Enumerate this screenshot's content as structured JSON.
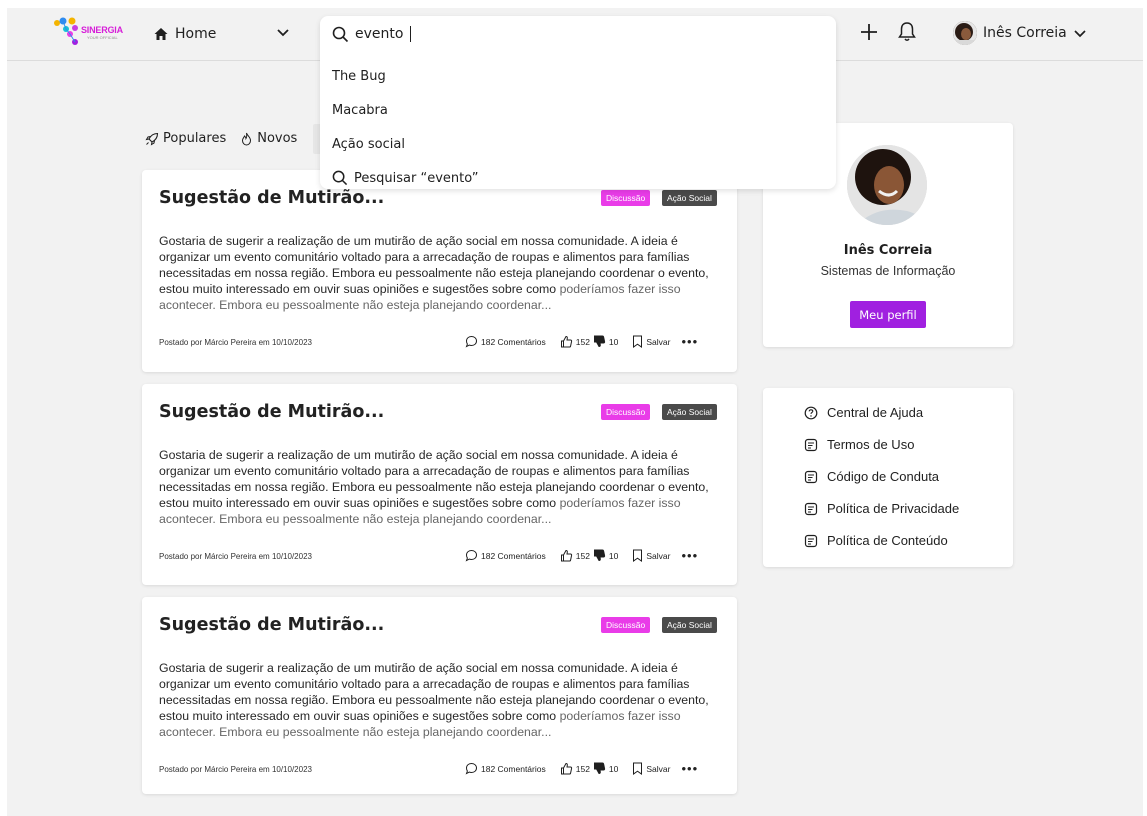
{
  "brand": {
    "name": "SINERGIA",
    "tagline": "YOUR OFFICIAL",
    "accent": "#a020e0",
    "tag_pink": "#e93ce8",
    "tag_dark": "#4a4a4a"
  },
  "nav": {
    "home_label": "Home"
  },
  "search": {
    "value": "evento",
    "suggestions": [
      "The Bug",
      "Macabra",
      "Ação social"
    ],
    "search_action": "Pesquisar “evento”"
  },
  "user": {
    "name": "Inês Correia"
  },
  "filters": [
    {
      "label": "Populares",
      "icon": "rocket-icon"
    },
    {
      "label": "Novos",
      "icon": "flame-icon"
    }
  ],
  "posts": [
    {
      "title": "Sugestão de Mutirão...",
      "tags": [
        "Discussão",
        "Ação Social"
      ],
      "body": "Gostaria de sugerir a realização de um mutirão de ação social em nossa comunidade. A ideia é organizar um evento comunitário voltado para a arrecadação de roupas e alimentos para famílias necessitadas em nossa região. Embora eu pessoalmente não esteja planejando coordenar o evento, estou muito interessado em ouvir suas opiniões e sugestões sobre como",
      "body_fade": "poderíamos fazer isso acontecer. Embora eu pessoalmente não esteja planejando coordenar...",
      "meta": "Postado por Márcio Pereira em 10/10/2023",
      "comments": "182 Comentários",
      "likes": "152",
      "dislikes": "10",
      "save": "Salvar"
    },
    {
      "title": "Sugestão de Mutirão...",
      "tags": [
        "Discussão",
        "Ação Social"
      ],
      "body": "Gostaria de sugerir a realização de um mutirão de ação social em nossa comunidade. A ideia é organizar um evento comunitário voltado para a arrecadação de roupas e alimentos para famílias necessitadas em nossa região. Embora eu pessoalmente não esteja planejando coordenar o evento, estou muito interessado em ouvir suas opiniões e sugestões sobre como",
      "body_fade": "poderíamos fazer isso acontecer. Embora eu pessoalmente não esteja planejando coordenar...",
      "meta": "Postado por Márcio Pereira em 10/10/2023",
      "comments": "182 Comentários",
      "likes": "152",
      "dislikes": "10",
      "save": "Salvar"
    },
    {
      "title": "Sugestão de Mutirão...",
      "tags": [
        "Discussão",
        "Ação Social"
      ],
      "body": "Gostaria de sugerir a realização de um mutirão de ação social em nossa comunidade. A ideia é organizar um evento comunitário voltado para a arrecadação de roupas e alimentos para famílias necessitadas em nossa região. Embora eu pessoalmente não esteja planejando coordenar o evento, estou muito interessado em ouvir suas opiniões e sugestões sobre como",
      "body_fade": "poderíamos fazer isso acontecer. Embora eu pessoalmente não esteja planejando coordenar...",
      "meta": "Postado por Márcio Pereira em 10/10/2023",
      "comments": "182 Comentários",
      "likes": "152",
      "dislikes": "10",
      "save": "Salvar"
    }
  ],
  "profile": {
    "name": "Inês Correia",
    "course": "Sistemas de Informação",
    "button": "Meu perfil"
  },
  "links": [
    "Central de Ajuda",
    "Termos de Uso",
    "Código de Conduta",
    "Política de Privacidade",
    "Política de Conteúdo"
  ]
}
